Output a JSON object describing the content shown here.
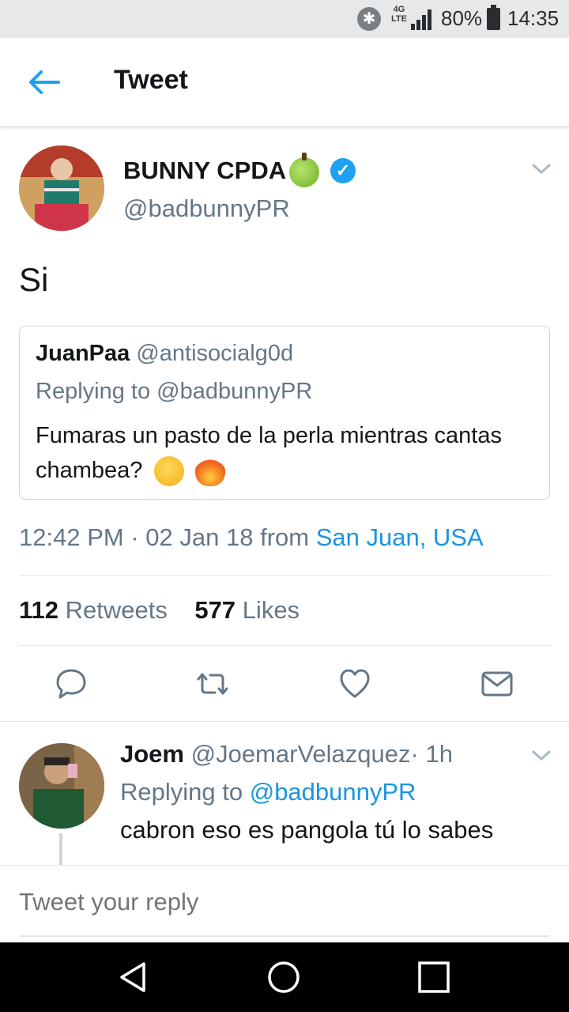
{
  "status_bar": {
    "network": "4G LTE",
    "battery": "80%",
    "time": "14:35",
    "icons": [
      "bluetooth-icon",
      "signal-icon",
      "battery-icon"
    ]
  },
  "header": {
    "title": "Tweet",
    "back_icon": "arrow-left-icon"
  },
  "tweet": {
    "author_name": "BUNNY CPDA",
    "author_handle": "@badbunnyPR",
    "author_badges": [
      "green-apple-emoji",
      "verified-badge-icon"
    ],
    "text": "Si",
    "quoted": {
      "name": "JuanPaa",
      "handle": "@antisocialg0d",
      "replying_to": "Replying to @badbunnyPR",
      "text": "Fumaras un pasto de la perla mientras cantas chambea?",
      "emojis": [
        "thinking-face-emoji",
        "fire-emoji"
      ]
    },
    "time": "12:42 PM",
    "dot": "·",
    "date": "02 Jan 18",
    "from": "from",
    "location": "San Juan, USA",
    "retweets_count": "112",
    "retweets_label": "Retweets",
    "likes_count": "577",
    "likes_label": "Likes",
    "actions": [
      "reply-icon",
      "retweet-icon",
      "like-icon",
      "direct-message-icon"
    ]
  },
  "reply": {
    "name": "Joem",
    "handle": "@JoemarVelazquez",
    "dot": "·",
    "age": "1h",
    "replying_prefix": "Replying to",
    "replying_handle": "@badbunnyPR",
    "text": "cabron eso es pangola tú lo sabes"
  },
  "compose": {
    "placeholder": "Tweet your reply"
  },
  "nav": [
    "back-triangle-icon",
    "home-circle-icon",
    "recents-square-icon"
  ],
  "colors": {
    "accent": "#1da1f2",
    "link": "#1b95e0",
    "muted": "#657786",
    "text": "#14171a"
  }
}
